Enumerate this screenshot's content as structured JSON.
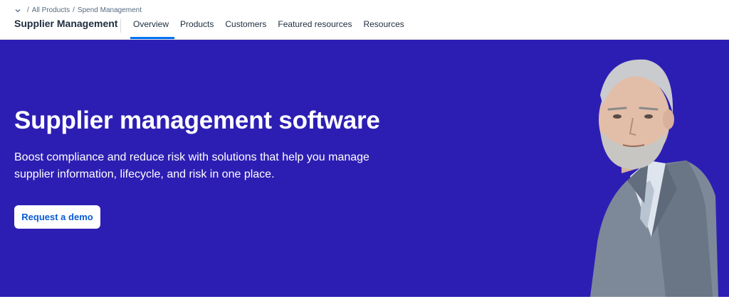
{
  "breadcrumb": {
    "items": [
      "All Products",
      "Spend Management"
    ],
    "separator": "/"
  },
  "header": {
    "title": "Supplier Management"
  },
  "nav": {
    "items": [
      {
        "label": "Overview",
        "active": true
      },
      {
        "label": "Products"
      },
      {
        "label": "Customers"
      },
      {
        "label": "Featured resources"
      },
      {
        "label": "Resources"
      }
    ]
  },
  "hero": {
    "title": "Supplier management software",
    "subtitle": "Boost compliance and reduce risk with solutions that help you manage supplier information, lifecycle, and risk in one place.",
    "cta_label": "Request a demo"
  },
  "colors": {
    "hero_background": "#2d1eb3",
    "active_tab": "#0070f2",
    "cta_text": "#0a5bd6"
  },
  "icons": {
    "breadcrumb_toggle": "chevron-down-icon"
  }
}
